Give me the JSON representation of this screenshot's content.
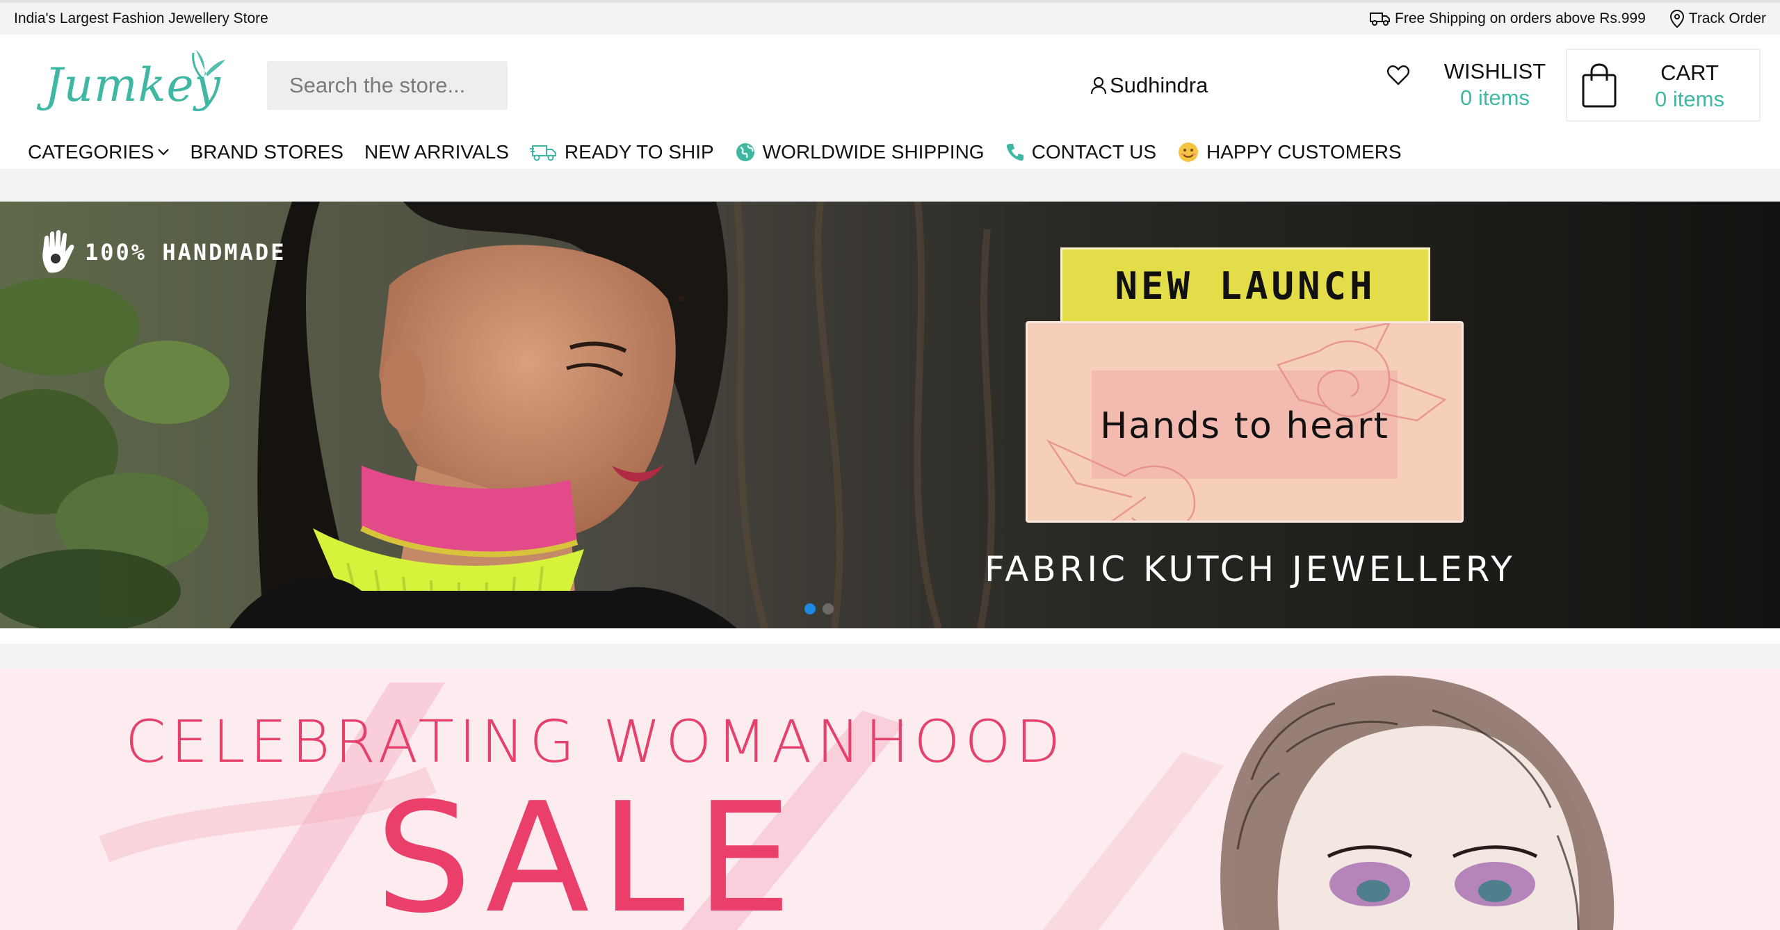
{
  "topbar": {
    "tagline": "India's Largest Fashion Jewellery Store",
    "shipping_text": "Free Shipping on orders above Rs.999",
    "track_order": "Track Order"
  },
  "header": {
    "logo": "Jumkey",
    "search_placeholder": "Search the store...",
    "user_name": "Sudhindra",
    "wishlist_label": "WISHLIST",
    "wishlist_count": "0 items",
    "cart_label": "CART",
    "cart_count": "0 items"
  },
  "nav": {
    "items": [
      {
        "label": "CATEGORIES",
        "icon": "chevron-down-icon"
      },
      {
        "label": "BRAND STORES"
      },
      {
        "label": "NEW ARRIVALS"
      },
      {
        "label": "READY TO SHIP",
        "icon": "delivery-truck-icon"
      },
      {
        "label": "WORLDWIDE SHIPPING",
        "icon": "globe-icon"
      },
      {
        "label": "CONTACT US",
        "icon": "phone-icon"
      },
      {
        "label": "HAPPY CUSTOMERS",
        "icon": "smiley-icon"
      }
    ]
  },
  "hero": {
    "badge": "100% HANDMADE",
    "tag": "NEW LAUNCH",
    "card_title": "Hands to heart",
    "collection": "FABRIC KUTCH JEWELLERY",
    "slides": 2,
    "active_slide": 1
  },
  "sale_banner": {
    "headline": "CELEBRATING WOMANHOOD",
    "sale": "SALE"
  },
  "colors": {
    "brand": "#3fb8a3",
    "sale_pink": "#ea3f6b",
    "launch_yellow": "#e4dd4a",
    "dot_active": "#1e88e5"
  }
}
